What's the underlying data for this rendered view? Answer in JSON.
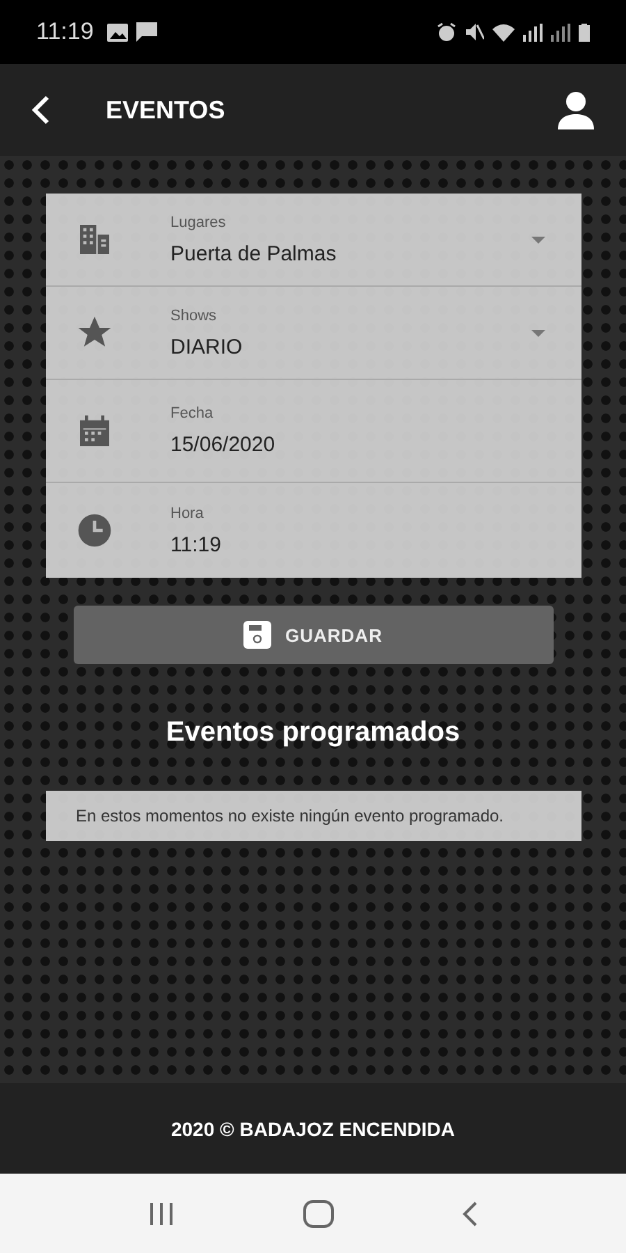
{
  "status_bar": {
    "time": "11:19"
  },
  "app_bar": {
    "title": "EVENTOS"
  },
  "form": {
    "rows": [
      {
        "kind": "dropdown",
        "label": "Lugares",
        "value": "Puerta de Palmas"
      },
      {
        "kind": "dropdown",
        "label": "Shows",
        "value": "DIARIO"
      },
      {
        "kind": "field",
        "label": "Fecha",
        "value": "15/06/2020"
      },
      {
        "kind": "field",
        "label": "Hora",
        "value": "11:19"
      }
    ]
  },
  "save_button": {
    "label": "GUARDAR"
  },
  "events": {
    "heading": "Eventos programados",
    "message": "En estos momentos no existe ningún evento programado."
  },
  "footer": {
    "text": "2020 © BADAJOZ ENCENDIDA"
  }
}
